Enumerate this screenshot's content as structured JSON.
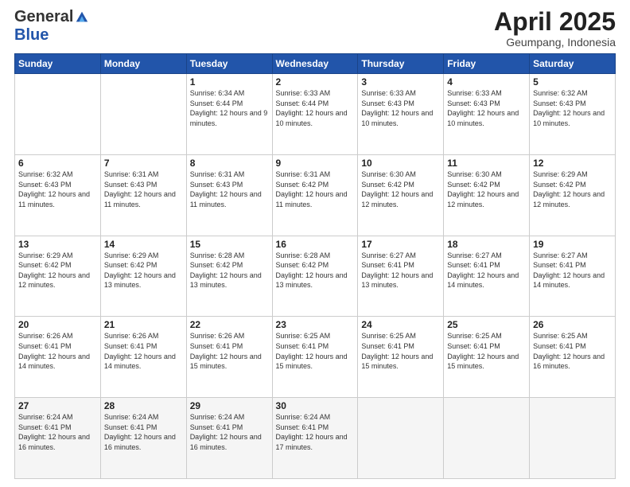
{
  "header": {
    "logo_general": "General",
    "logo_blue": "Blue",
    "month_title": "April 2025",
    "subtitle": "Geumpang, Indonesia"
  },
  "days_of_week": [
    "Sunday",
    "Monday",
    "Tuesday",
    "Wednesday",
    "Thursday",
    "Friday",
    "Saturday"
  ],
  "weeks": [
    [
      {
        "day": "",
        "info": ""
      },
      {
        "day": "",
        "info": ""
      },
      {
        "day": "1",
        "info": "Sunrise: 6:34 AM\nSunset: 6:44 PM\nDaylight: 12 hours and 9 minutes."
      },
      {
        "day": "2",
        "info": "Sunrise: 6:33 AM\nSunset: 6:44 PM\nDaylight: 12 hours and 10 minutes."
      },
      {
        "day": "3",
        "info": "Sunrise: 6:33 AM\nSunset: 6:43 PM\nDaylight: 12 hours and 10 minutes."
      },
      {
        "day": "4",
        "info": "Sunrise: 6:33 AM\nSunset: 6:43 PM\nDaylight: 12 hours and 10 minutes."
      },
      {
        "day": "5",
        "info": "Sunrise: 6:32 AM\nSunset: 6:43 PM\nDaylight: 12 hours and 10 minutes."
      }
    ],
    [
      {
        "day": "6",
        "info": "Sunrise: 6:32 AM\nSunset: 6:43 PM\nDaylight: 12 hours and 11 minutes."
      },
      {
        "day": "7",
        "info": "Sunrise: 6:31 AM\nSunset: 6:43 PM\nDaylight: 12 hours and 11 minutes."
      },
      {
        "day": "8",
        "info": "Sunrise: 6:31 AM\nSunset: 6:43 PM\nDaylight: 12 hours and 11 minutes."
      },
      {
        "day": "9",
        "info": "Sunrise: 6:31 AM\nSunset: 6:42 PM\nDaylight: 12 hours and 11 minutes."
      },
      {
        "day": "10",
        "info": "Sunrise: 6:30 AM\nSunset: 6:42 PM\nDaylight: 12 hours and 12 minutes."
      },
      {
        "day": "11",
        "info": "Sunrise: 6:30 AM\nSunset: 6:42 PM\nDaylight: 12 hours and 12 minutes."
      },
      {
        "day": "12",
        "info": "Sunrise: 6:29 AM\nSunset: 6:42 PM\nDaylight: 12 hours and 12 minutes."
      }
    ],
    [
      {
        "day": "13",
        "info": "Sunrise: 6:29 AM\nSunset: 6:42 PM\nDaylight: 12 hours and 12 minutes."
      },
      {
        "day": "14",
        "info": "Sunrise: 6:29 AM\nSunset: 6:42 PM\nDaylight: 12 hours and 13 minutes."
      },
      {
        "day": "15",
        "info": "Sunrise: 6:28 AM\nSunset: 6:42 PM\nDaylight: 12 hours and 13 minutes."
      },
      {
        "day": "16",
        "info": "Sunrise: 6:28 AM\nSunset: 6:42 PM\nDaylight: 12 hours and 13 minutes."
      },
      {
        "day": "17",
        "info": "Sunrise: 6:27 AM\nSunset: 6:41 PM\nDaylight: 12 hours and 13 minutes."
      },
      {
        "day": "18",
        "info": "Sunrise: 6:27 AM\nSunset: 6:41 PM\nDaylight: 12 hours and 14 minutes."
      },
      {
        "day": "19",
        "info": "Sunrise: 6:27 AM\nSunset: 6:41 PM\nDaylight: 12 hours and 14 minutes."
      }
    ],
    [
      {
        "day": "20",
        "info": "Sunrise: 6:26 AM\nSunset: 6:41 PM\nDaylight: 12 hours and 14 minutes."
      },
      {
        "day": "21",
        "info": "Sunrise: 6:26 AM\nSunset: 6:41 PM\nDaylight: 12 hours and 14 minutes."
      },
      {
        "day": "22",
        "info": "Sunrise: 6:26 AM\nSunset: 6:41 PM\nDaylight: 12 hours and 15 minutes."
      },
      {
        "day": "23",
        "info": "Sunrise: 6:25 AM\nSunset: 6:41 PM\nDaylight: 12 hours and 15 minutes."
      },
      {
        "day": "24",
        "info": "Sunrise: 6:25 AM\nSunset: 6:41 PM\nDaylight: 12 hours and 15 minutes."
      },
      {
        "day": "25",
        "info": "Sunrise: 6:25 AM\nSunset: 6:41 PM\nDaylight: 12 hours and 15 minutes."
      },
      {
        "day": "26",
        "info": "Sunrise: 6:25 AM\nSunset: 6:41 PM\nDaylight: 12 hours and 16 minutes."
      }
    ],
    [
      {
        "day": "27",
        "info": "Sunrise: 6:24 AM\nSunset: 6:41 PM\nDaylight: 12 hours and 16 minutes."
      },
      {
        "day": "28",
        "info": "Sunrise: 6:24 AM\nSunset: 6:41 PM\nDaylight: 12 hours and 16 minutes."
      },
      {
        "day": "29",
        "info": "Sunrise: 6:24 AM\nSunset: 6:41 PM\nDaylight: 12 hours and 16 minutes."
      },
      {
        "day": "30",
        "info": "Sunrise: 6:24 AM\nSunset: 6:41 PM\nDaylight: 12 hours and 17 minutes."
      },
      {
        "day": "",
        "info": ""
      },
      {
        "day": "",
        "info": ""
      },
      {
        "day": "",
        "info": ""
      }
    ]
  ]
}
